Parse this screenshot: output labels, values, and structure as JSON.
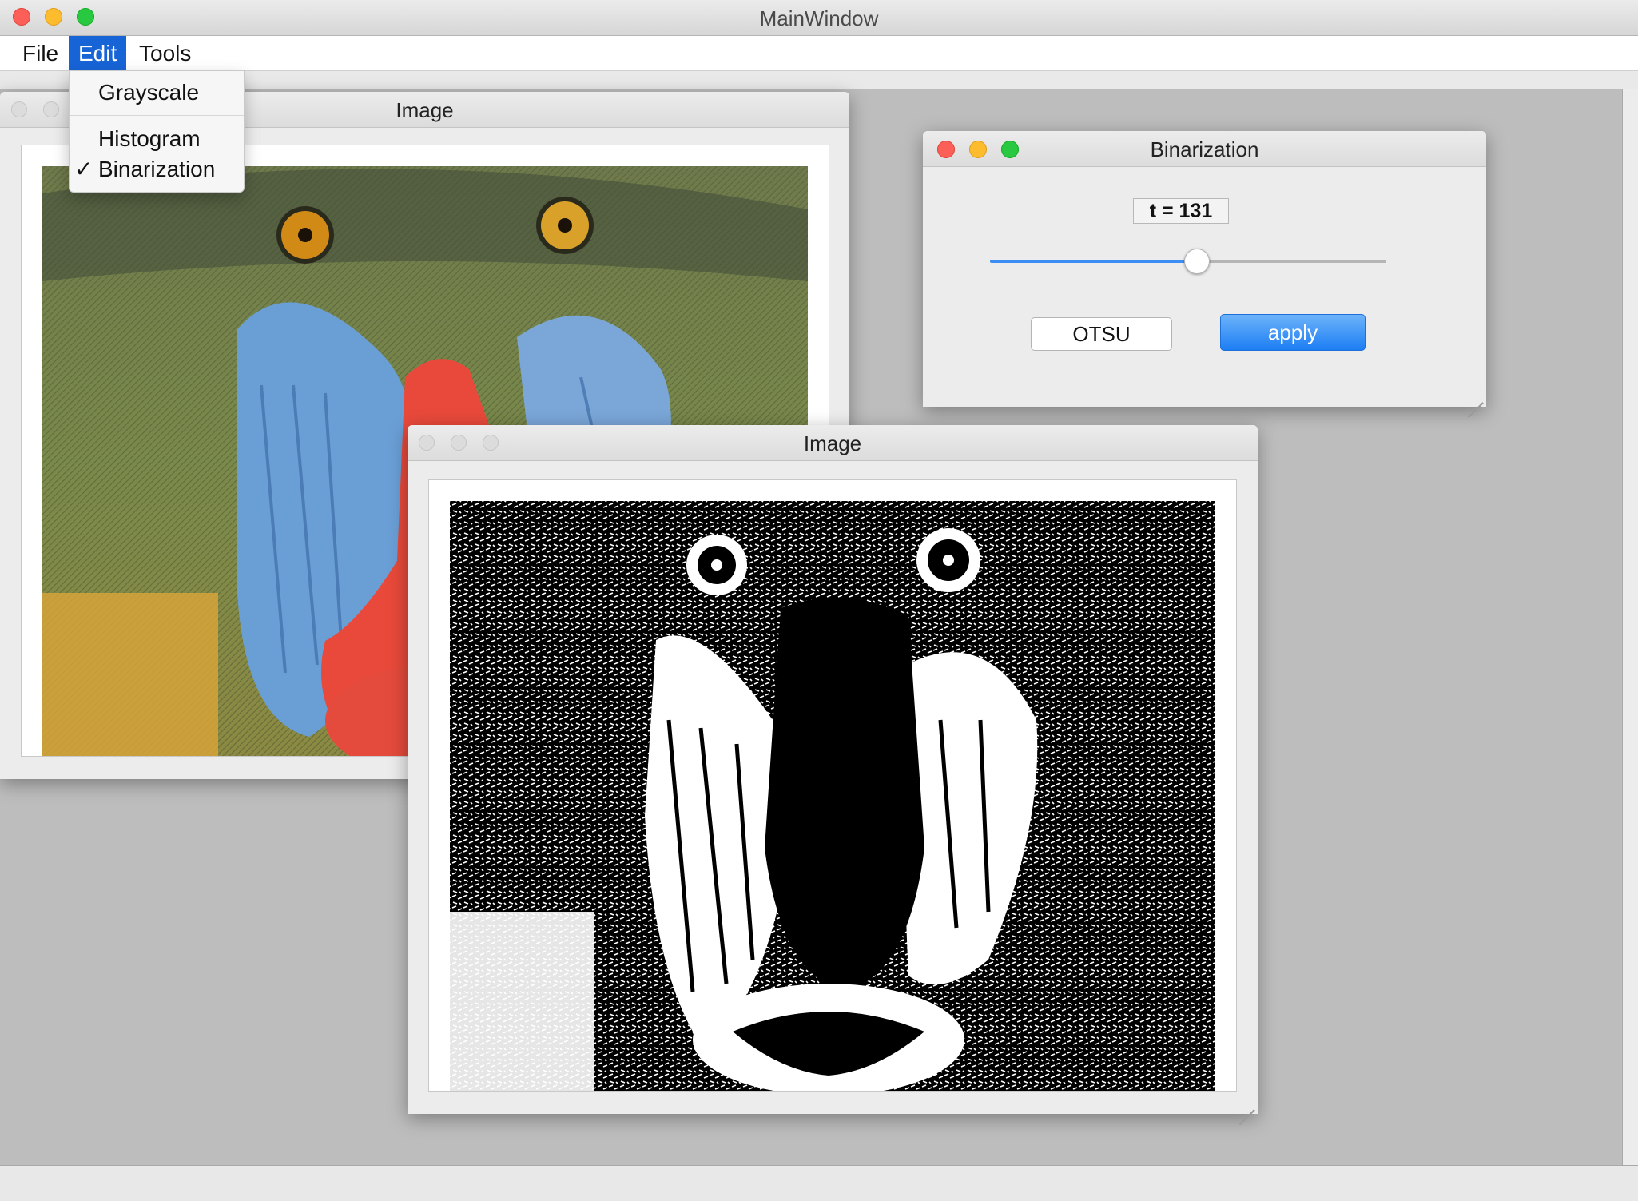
{
  "main_window": {
    "title": "MainWindow",
    "menus": [
      "File",
      "Edit",
      "Tools"
    ]
  },
  "edit_menu": {
    "items": [
      {
        "label": "Grayscale",
        "checked": false
      },
      {
        "label": "Histogram",
        "checked": false
      },
      {
        "label": "Binarization",
        "checked": true
      }
    ],
    "check_glyph": "✓"
  },
  "image_window_color": {
    "title": "Image",
    "image": "mandrill-color-photo"
  },
  "image_window_binary": {
    "title": "Image",
    "image": "mandrill-binarized-black-white"
  },
  "binarization": {
    "title": "Binarization",
    "threshold_label": "t = 131",
    "threshold_value": 131,
    "slider_fraction": 0.52,
    "otsu_label": "OTSU",
    "apply_label": "apply"
  },
  "colors": {
    "menu_highlight": "#1764d7",
    "slider_accent": "#3c8ef4",
    "apply_button": "#1d7ef3"
  }
}
